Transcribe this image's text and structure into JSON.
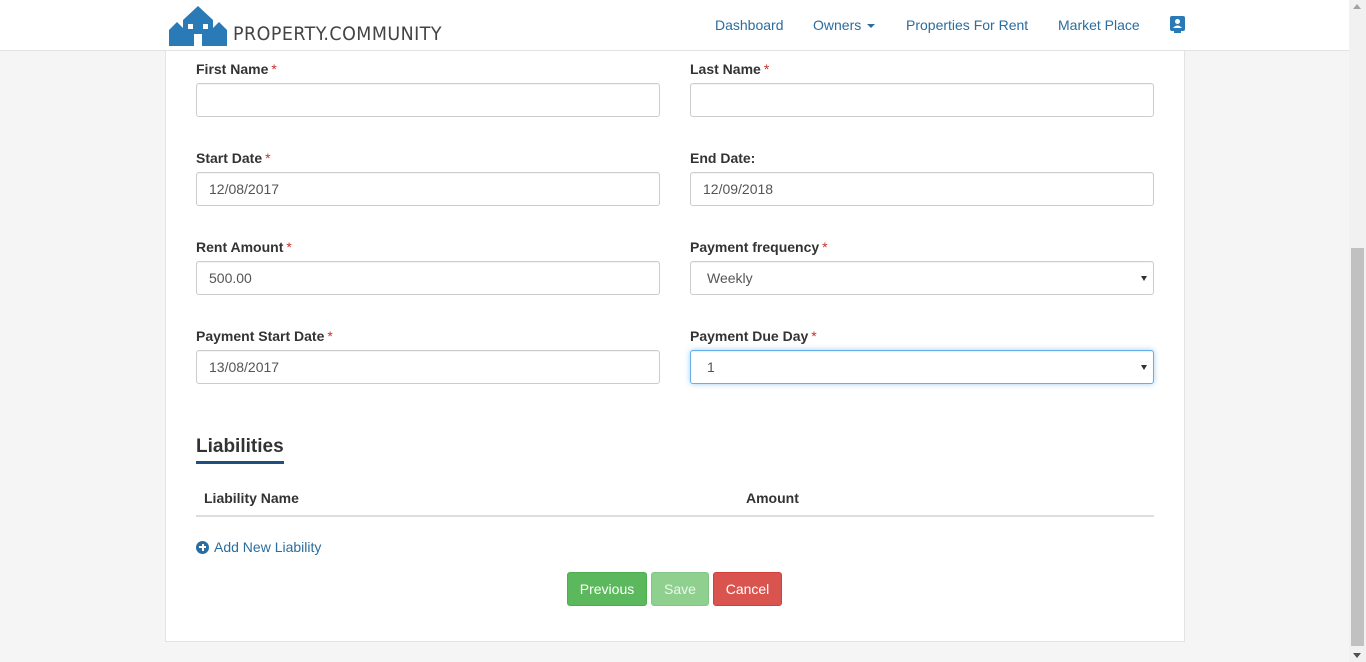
{
  "brand": {
    "name": "PROPERTY.COMMUNITY",
    "logo_icon": "house-logo-icon"
  },
  "nav": {
    "items": [
      {
        "label": "Dashboard"
      },
      {
        "label": "Owners"
      },
      {
        "label": "Properties For Rent"
      },
      {
        "label": "Market Place"
      }
    ],
    "profile_icon": "contact-card-icon"
  },
  "form": {
    "required_mark": "*",
    "first_name": {
      "label": "First Name",
      "value": ""
    },
    "last_name": {
      "label": "Last Name",
      "value": ""
    },
    "start_date": {
      "label": "Start Date",
      "value": "12/08/2017"
    },
    "end_date": {
      "label": "End Date:",
      "value": "12/09/2018"
    },
    "rent_amount": {
      "label": "Rent Amount",
      "value": "500.00"
    },
    "payment_frequency": {
      "label": "Payment frequency",
      "value": "Weekly"
    },
    "payment_start_date": {
      "label": "Payment Start Date",
      "value": "13/08/2017"
    },
    "payment_due_day": {
      "label": "Payment Due Day",
      "value": "1"
    }
  },
  "liabilities": {
    "title": "Liabilities",
    "columns": [
      "Liability Name",
      "Amount"
    ],
    "add_label": "Add New Liability"
  },
  "buttons": {
    "previous": "Previous",
    "save": "Save",
    "cancel": "Cancel"
  },
  "colors": {
    "link": "#2a6d9e",
    "success": "#5cb85c",
    "danger": "#d9534f",
    "required": "#c9302c",
    "section_underline": "#1f4f7e"
  }
}
